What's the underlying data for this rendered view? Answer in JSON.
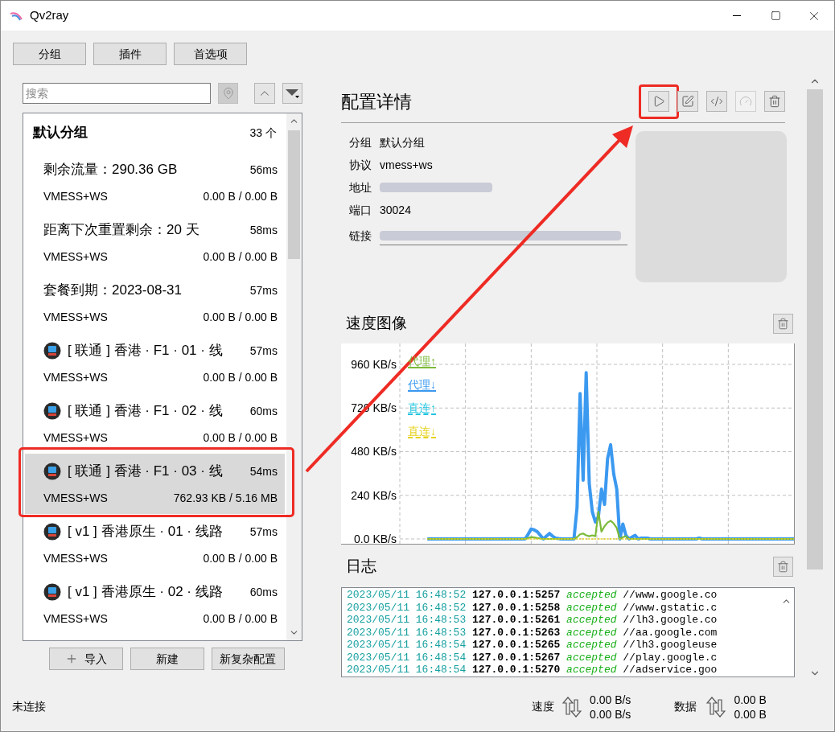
{
  "window": {
    "title": "Qv2ray"
  },
  "top_buttons": [
    "分组",
    "插件",
    "首选项"
  ],
  "search": {
    "placeholder": "搜索",
    "locate_disabled": true
  },
  "group": {
    "name": "默认分组",
    "count": "33 个"
  },
  "servers": [
    {
      "name": "剩余流量：290.36 GB",
      "latency": "56ms",
      "protocol": "VMESS+WS",
      "usage": "0.00 B / 0.00 B",
      "icon": false,
      "selected": false,
      "highlighted": false
    },
    {
      "name": "距离下次重置剩余：20 天",
      "latency": "58ms",
      "protocol": "VMESS+WS",
      "usage": "0.00 B / 0.00 B",
      "icon": false,
      "selected": false,
      "highlighted": false
    },
    {
      "name": "套餐到期：2023-08-31",
      "latency": "57ms",
      "protocol": "VMESS+WS",
      "usage": "0.00 B / 0.00 B",
      "icon": false,
      "selected": false,
      "highlighted": false
    },
    {
      "name": "[ 联通 ] 香港 · F1 · 01 · 线",
      "latency": "57ms",
      "protocol": "VMESS+WS",
      "usage": "0.00 B / 0.00 B",
      "icon": true,
      "selected": false,
      "highlighted": false
    },
    {
      "name": "[ 联通 ] 香港 · F1 · 02 · 线",
      "latency": "60ms",
      "protocol": "VMESS+WS",
      "usage": "0.00 B / 0.00 B",
      "icon": true,
      "selected": false,
      "highlighted": false
    },
    {
      "name": "[ 联通 ] 香港 · F1 · 03 · 线",
      "latency": "54ms",
      "protocol": "VMESS+WS",
      "usage": "762.93 KB / 5.16 MB",
      "icon": true,
      "selected": true,
      "highlighted": true
    },
    {
      "name": "[ v1 ] 香港原生 · 01 · 线路",
      "latency": "57ms",
      "protocol": "VMESS+WS",
      "usage": "0.00 B / 0.00 B",
      "icon": true,
      "selected": false,
      "highlighted": false
    },
    {
      "name": "[ v1 ] 香港原生 · 02 · 线路",
      "latency": "60ms",
      "protocol": "VMESS+WS",
      "usage": "0.00 B / 0.00 B",
      "icon": true,
      "selected": false,
      "highlighted": false
    }
  ],
  "bottom_buttons": [
    "导入",
    "新建",
    "新复杂配置"
  ],
  "details": {
    "title": "配置详情",
    "buttons": [
      {
        "disabled": false,
        "highlighted": true
      },
      {
        "disabled": false,
        "highlighted": false
      },
      {
        "disabled": false,
        "highlighted": false
      },
      {
        "disabled": true,
        "highlighted": false
      },
      {
        "disabled": false,
        "highlighted": false
      }
    ],
    "rows": [
      {
        "label": "分组",
        "kind": "text",
        "value": "默认分组"
      },
      {
        "label": "协议",
        "kind": "text",
        "value": "vmess+ws"
      },
      {
        "label": "地址",
        "kind": "blurred"
      },
      {
        "label": "端口",
        "kind": "text",
        "value": "30024"
      },
      {
        "label": "链接",
        "kind": "blurred-field"
      }
    ]
  },
  "speed": {
    "title": "速度图像",
    "chart_data": {
      "type": "line",
      "grid": true,
      "legend": true,
      "categories": [
        null,
        null,
        null,
        null,
        null,
        null,
        null,
        null,
        null,
        null,
        null,
        null,
        null,
        null,
        null,
        null,
        null,
        null,
        null,
        null,
        null,
        null,
        null,
        null,
        null,
        null,
        null,
        null,
        null,
        null,
        null,
        null,
        null,
        null,
        null,
        null,
        null,
        null,
        null,
        null,
        null,
        null,
        null,
        null,
        null,
        null,
        null,
        null,
        null,
        null,
        null,
        null,
        null,
        null,
        null,
        null,
        null,
        null,
        null,
        null,
        null,
        null,
        null,
        null,
        null,
        null,
        null,
        null,
        null,
        null,
        null,
        null,
        null,
        null,
        null,
        null,
        null,
        null,
        null,
        null,
        null,
        null,
        null,
        null,
        null,
        null,
        null,
        null,
        null,
        null,
        null,
        null,
        null,
        null,
        null,
        null,
        null,
        null,
        null,
        null,
        null,
        null,
        null,
        null,
        null,
        null,
        null,
        null,
        null,
        null,
        null,
        null,
        null,
        null,
        null,
        null,
        null,
        null,
        null,
        null,
        null,
        null,
        null,
        null,
        null,
        null,
        null,
        null,
        null,
        null
      ],
      "ylim": [
        -31,
        1075
      ],
      "yticks": [
        {
          "value": 0,
          "label": "0.0 KB/s"
        },
        {
          "value": 240,
          "label": "240 KB/s"
        },
        {
          "value": 480,
          "label": "480 KB/s"
        },
        {
          "value": 720,
          "label": "720 KB/s"
        },
        {
          "value": 960,
          "label": "960 KB/s"
        }
      ],
      "series": [
        {
          "name": "代理↑",
          "color": "#7cba3a",
          "line_style": "solid",
          "values": [
            null,
            null,
            null,
            null,
            null,
            null,
            null,
            null,
            null,
            0,
            0,
            0,
            0,
            0,
            0,
            0,
            0,
            0,
            0,
            0,
            0,
            0,
            0,
            0,
            0,
            0,
            0,
            0,
            0,
            0,
            0,
            0,
            0,
            0,
            0,
            0,
            0,
            0,
            0,
            0,
            0,
            0,
            5,
            10,
            8,
            5,
            2,
            0,
            0,
            0,
            0,
            0,
            0,
            0,
            0,
            0,
            0,
            0,
            10,
            25,
            30,
            20,
            15,
            20,
            15,
            150,
            40,
            70,
            90,
            100,
            85,
            60,
            0,
            10,
            15,
            0,
            0,
            0,
            0,
            0,
            0,
            0,
            0,
            0,
            0,
            0,
            0,
            0,
            0,
            0,
            0,
            0,
            0,
            0,
            0,
            0,
            0,
            0,
            0,
            0,
            0,
            0,
            0,
            0,
            0,
            0,
            0,
            0,
            0,
            0,
            0,
            0,
            0,
            0,
            0,
            0,
            0,
            0,
            0,
            0,
            0,
            0,
            0,
            0,
            0,
            0,
            0,
            0,
            0,
            0
          ]
        },
        {
          "name": "代理↓",
          "color": "#3b99f0",
          "line_style": "solid",
          "values": [
            null,
            null,
            null,
            null,
            null,
            null,
            null,
            null,
            null,
            0,
            0,
            0,
            0,
            0,
            0,
            0,
            0,
            0,
            0,
            0,
            0,
            0,
            0,
            0,
            0,
            0,
            0,
            0,
            0,
            0,
            0,
            0,
            0,
            0,
            0,
            0,
            0,
            0,
            0,
            0,
            0,
            0,
            25,
            55,
            50,
            40,
            20,
            0,
            15,
            30,
            15,
            5,
            2,
            0,
            0,
            0,
            0,
            0,
            172,
            800,
            323,
            915,
            305,
            150,
            93,
            124,
            274,
            190,
            442,
            518,
            358,
            274,
            0,
            82,
            20,
            0,
            10,
            20,
            0,
            5,
            5,
            5,
            0,
            0,
            0,
            0,
            0,
            0,
            0,
            0,
            0,
            0,
            0,
            0,
            0,
            0,
            0,
            0,
            5,
            0,
            0,
            0,
            0,
            0,
            0,
            0,
            0,
            0,
            0,
            0,
            0,
            0,
            0,
            0,
            0,
            0,
            0,
            0,
            0,
            0,
            0,
            0,
            0,
            0,
            0,
            0,
            0,
            0,
            0,
            0
          ]
        },
        {
          "name": "直连↑",
          "color": "#22c5e0",
          "line_style": "dashed",
          "values": [
            null,
            null,
            null,
            null,
            null,
            null,
            null,
            null,
            null,
            null,
            null,
            null,
            null,
            null,
            null,
            null,
            null,
            null,
            null,
            null,
            null,
            null,
            null,
            null,
            null,
            null,
            null,
            null,
            null,
            null,
            null,
            null,
            null,
            null,
            null,
            null,
            null,
            null,
            null,
            null,
            null,
            null,
            null,
            null,
            null,
            null,
            null,
            null,
            null,
            null,
            null,
            null,
            null,
            null,
            null,
            null,
            null,
            null,
            null,
            null,
            null,
            null,
            null,
            null,
            null,
            null,
            null,
            null,
            null,
            null,
            null,
            null,
            null,
            null,
            null,
            null,
            null,
            null,
            null,
            null,
            null,
            null,
            null,
            null,
            null,
            null,
            null,
            null,
            null,
            null,
            null,
            null,
            null,
            null,
            null,
            null,
            null,
            null,
            null,
            null,
            null,
            null,
            null,
            null,
            null,
            null,
            null,
            null,
            null,
            null,
            null,
            null,
            null,
            null,
            null,
            null,
            null,
            null,
            null,
            null,
            null,
            null,
            null,
            null,
            null,
            null,
            null,
            null,
            null,
            null
          ]
        },
        {
          "name": "直连↓",
          "color": "#e6d21b",
          "line_style": "dashed",
          "values": [
            null,
            null,
            null,
            null,
            null,
            null,
            null,
            null,
            null,
            0,
            0,
            0,
            0,
            0,
            0,
            0,
            0,
            0,
            0,
            0,
            0,
            0,
            0,
            0,
            0,
            0,
            0,
            0,
            0,
            0,
            0,
            0,
            0,
            0,
            0,
            0,
            0,
            0,
            0,
            0,
            0,
            0,
            0,
            0,
            0,
            0,
            0,
            0,
            0,
            0,
            0,
            0,
            0,
            0,
            0,
            0,
            0,
            0,
            0,
            0,
            0,
            0,
            0,
            0,
            0,
            0,
            0,
            0,
            0,
            0,
            0,
            0,
            0,
            0,
            0,
            0,
            0,
            0,
            0,
            0,
            0,
            0,
            0,
            0,
            0,
            0,
            0,
            0,
            0,
            0,
            0,
            0,
            0,
            0,
            0,
            0,
            0,
            0,
            0,
            0,
            0,
            0,
            0,
            0,
            0,
            0,
            0,
            0,
            0,
            0,
            0,
            0,
            0,
            0,
            0,
            0,
            0,
            0,
            0,
            0,
            0,
            0,
            0,
            0,
            0,
            0,
            0,
            0,
            0,
            0
          ]
        }
      ]
    }
  },
  "log": {
    "title": "日志",
    "lines": [
      {
        "time": "2023/05/11 16:48:52",
        "address": "127.0.0.1:5257",
        "status": "accepted",
        "target": "//www.google.co"
      },
      {
        "time": "2023/05/11 16:48:52",
        "address": "127.0.0.1:5258",
        "status": "accepted",
        "target": "//www.gstatic.c"
      },
      {
        "time": "2023/05/11 16:48:53",
        "address": "127.0.0.1:5261",
        "status": "accepted",
        "target": "//lh3.google.co"
      },
      {
        "time": "2023/05/11 16:48:53",
        "address": "127.0.0.1:5263",
        "status": "accepted",
        "target": "//aa.google.com"
      },
      {
        "time": "2023/05/11 16:48:54",
        "address": "127.0.0.1:5265",
        "status": "accepted",
        "target": "//lh3.googleuse"
      },
      {
        "time": "2023/05/11 16:48:54",
        "address": "127.0.0.1:5267",
        "status": "accepted",
        "target": "//play.google.c"
      },
      {
        "time": "2023/05/11 16:48:54",
        "address": "127.0.0.1:5270",
        "status": "accepted",
        "target": "//adservice.goo"
      }
    ]
  },
  "status_bar": {
    "connection": "未连接",
    "speed_label": "速度",
    "speed_up": "0.00 B/s",
    "speed_down": "0.00 B/s",
    "data_label": "数据",
    "data_up": "0.00 B",
    "data_down": "0.00 B"
  }
}
